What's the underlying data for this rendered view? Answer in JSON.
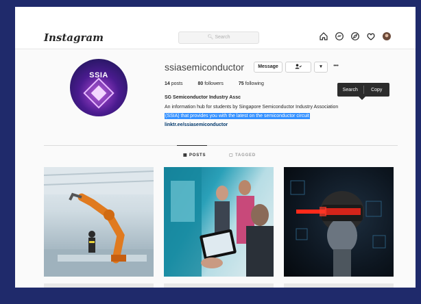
{
  "app": {
    "logo": "Instagram"
  },
  "search": {
    "placeholder": "Search"
  },
  "nav": {
    "icons": [
      "home-icon",
      "messenger-icon",
      "explore-icon",
      "heart-icon",
      "profile-avatar"
    ]
  },
  "profile": {
    "avatar_text": "SSIA",
    "username": "ssiasemiconductor",
    "message_label": "Message",
    "follow_label": "▾",
    "more_label": "•••",
    "stats": [
      {
        "count": "14",
        "label": "posts"
      },
      {
        "count": "80",
        "label": "followers"
      },
      {
        "count": "75",
        "label": "following"
      }
    ],
    "bio_name": "SG Semiconductor Industry Assc",
    "bio_line1": "An information hub for students by Singapore Semiconductor Industry Association",
    "bio_line2": "(SSIA) that provides you with the latest on the semiconductor circuit",
    "link": "linktr.ee/ssiasemiconductor"
  },
  "context_menu": {
    "search_label": "Search",
    "copy_label": "Copy"
  },
  "tabs": {
    "posts_label": "POSTS",
    "tagged_label": "TAGGED"
  },
  "colors": {
    "selection": "#3390ff",
    "background": "#1f2a6b",
    "link": "#00376b"
  }
}
